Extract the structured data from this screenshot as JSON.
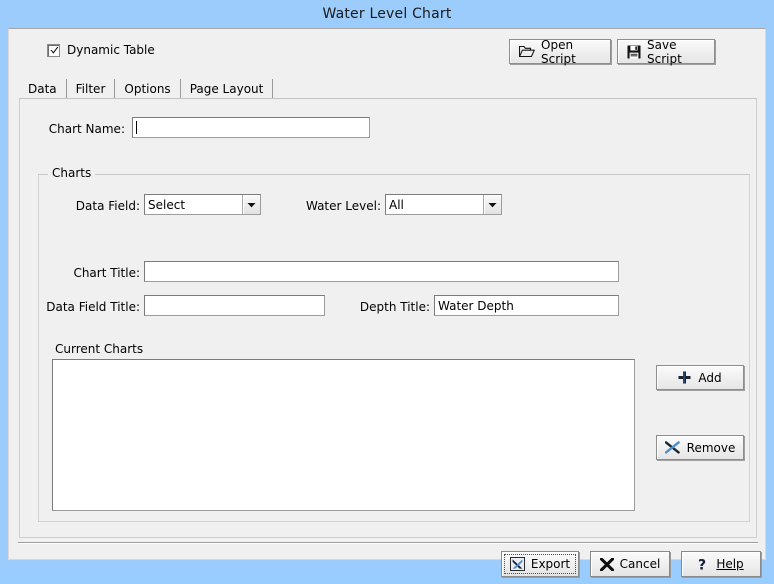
{
  "window": {
    "title": "Water Level Chart",
    "titlebar_color": "#9bccfb",
    "client_color": "#f0f0f0"
  },
  "toolbar": {
    "dynamic_table_label": "Dynamic Table",
    "dynamic_table_checked": true,
    "open_script_label": "Open Script",
    "open_script_icon": "open-folder-icon",
    "save_script_label": "Save Script",
    "save_script_icon": "floppy-disk-icon"
  },
  "tabs": [
    {
      "label": "Data",
      "selected": true
    },
    {
      "label": "Filter",
      "selected": false
    },
    {
      "label": "Options",
      "selected": false
    },
    {
      "label": "Page Layout",
      "selected": false
    }
  ],
  "form": {
    "chart_name_label": "Chart Name:",
    "chart_name_value": "",
    "charts_group_legend": "Charts",
    "data_field_label": "Data Field:",
    "data_field_value": "Select",
    "water_level_label": "Water Level:",
    "water_level_value": "All",
    "chart_title_label": "Chart Title:",
    "chart_title_value": "",
    "data_field_title_label": "Data Field Title:",
    "data_field_title_value": "",
    "depth_title_label": "Depth Title:",
    "depth_title_value": "Water Depth",
    "current_charts_label": "Current Charts",
    "current_charts_items": []
  },
  "side_buttons": {
    "add_label": "Add",
    "add_icon": "plus-icon",
    "remove_label": "Remove",
    "remove_icon": "x-cross-icon"
  },
  "footer": {
    "export_label": "Export",
    "export_icon": "excel-x-icon",
    "export_default": true,
    "cancel_label": "Cancel",
    "cancel_icon": "x-icon",
    "help_label": "Help",
    "help_icon": "question-mark-icon"
  },
  "colors": {
    "title_bar": "#9bccfb",
    "dialog_face": "#f0f0f0",
    "field_bg": "#ffffff",
    "accent_blue": "#2f6fba",
    "icon_dark": "#1b1b2f"
  }
}
